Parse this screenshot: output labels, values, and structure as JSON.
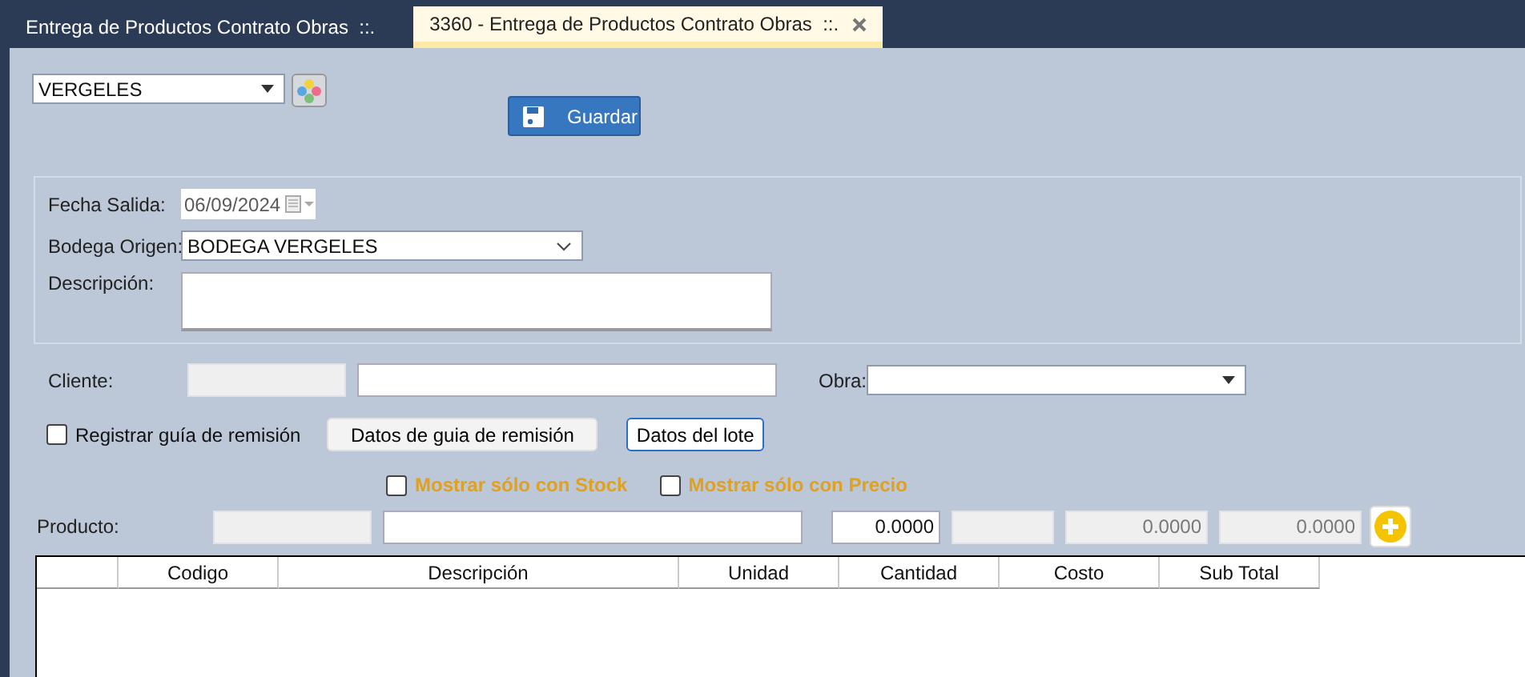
{
  "tabs": [
    {
      "label": "Entrega de Productos Contrato Obras  ::.",
      "selected": false
    },
    {
      "label": "3360 - Entrega de Productos Contrato Obras  ::.",
      "selected": true
    }
  ],
  "company_select": {
    "value": "VERGELES"
  },
  "save_button": {
    "label": "Guardar"
  },
  "header_group": {
    "fecha_salida": {
      "label": "Fecha Salida:",
      "value": "06/09/2024",
      "disabled": true
    },
    "bodega_origen": {
      "label": "Bodega Origen:",
      "value": "BODEGA VERGELES"
    },
    "descripcion": {
      "label": "Descripción:"
    }
  },
  "cliente": {
    "label": "Cliente:"
  },
  "obra": {
    "label": "Obra:"
  },
  "registrar_guia": {
    "label": "Registrar guía de remisión",
    "checked": false
  },
  "buttons": [
    {
      "label": "Datos de guia de remisión",
      "focused": false
    },
    {
      "label": "Datos del lote",
      "focused": true
    }
  ],
  "filters": [
    {
      "label": "Mostrar sólo con Stock",
      "checked": false
    },
    {
      "label": "Mostrar sólo con Precio",
      "checked": false
    }
  ],
  "producto": {
    "label": "Producto:",
    "cantidad": "0.0000",
    "costo": "0.0000",
    "subtotal": "0.0000"
  },
  "table": {
    "columns": [
      "Codigo",
      "Descripción",
      "Unidad",
      "Cantidad",
      "Costo",
      "Sub Total"
    ]
  }
}
